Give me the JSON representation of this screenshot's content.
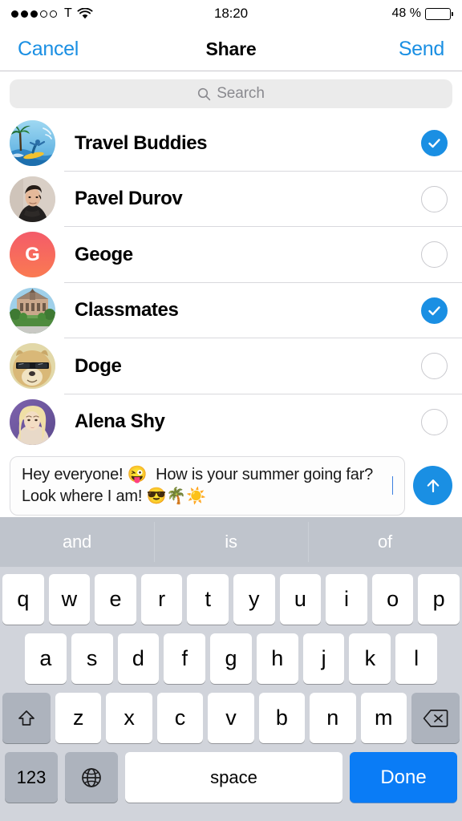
{
  "status_bar": {
    "signal_dots_filled": 3,
    "signal_dots_empty": 2,
    "carrier": "T",
    "wifi_icon": "wifi-icon",
    "time": "18:20",
    "battery_text": "48 %",
    "battery_percent": 48
  },
  "nav": {
    "cancel_label": "Cancel",
    "title": "Share",
    "send_label": "Send"
  },
  "search": {
    "placeholder": "Search",
    "icon": "search-icon"
  },
  "chats": [
    {
      "name": "Travel Buddies",
      "avatar": "beach-surfer-photo",
      "selected": true
    },
    {
      "name": "Pavel Durov",
      "avatar": "man-portrait-photo",
      "selected": false
    },
    {
      "name": "Geoge",
      "avatar": "initial-letter",
      "initial": "G",
      "avatar_color": "#f8615a",
      "selected": false
    },
    {
      "name": "Classmates",
      "avatar": "campus-building-photo",
      "selected": true
    },
    {
      "name": "Doge",
      "avatar": "doge-sunglasses-photo",
      "selected": false
    },
    {
      "name": "Alena Shy",
      "avatar": "blonde-woman-photo",
      "selected": false
    }
  ],
  "composer": {
    "message": "Hey everyone! 😜  How is your summer going far? Look where I am! 😎🌴☀️",
    "send_icon": "arrow-up-icon"
  },
  "keyboard": {
    "predictions": [
      "and",
      "is",
      "of"
    ],
    "row1": [
      "q",
      "w",
      "e",
      "r",
      "t",
      "y",
      "u",
      "i",
      "o",
      "p"
    ],
    "row2": [
      "a",
      "s",
      "d",
      "f",
      "g",
      "h",
      "j",
      "k",
      "l"
    ],
    "row3": [
      "z",
      "x",
      "c",
      "v",
      "b",
      "n",
      "m"
    ],
    "shift_icon": "shift-arrow-icon",
    "backspace_icon": "backspace-icon",
    "numbers_label": "123",
    "globe_icon": "globe-icon",
    "space_label": "space",
    "done_label": "Done"
  },
  "colors": {
    "accent_blue": "#1a8fe3",
    "key_blue": "#0a7cf6",
    "separator": "#d9d9dd",
    "search_bg": "#ebebeb",
    "keyboard_bg": "#d1d4db"
  }
}
